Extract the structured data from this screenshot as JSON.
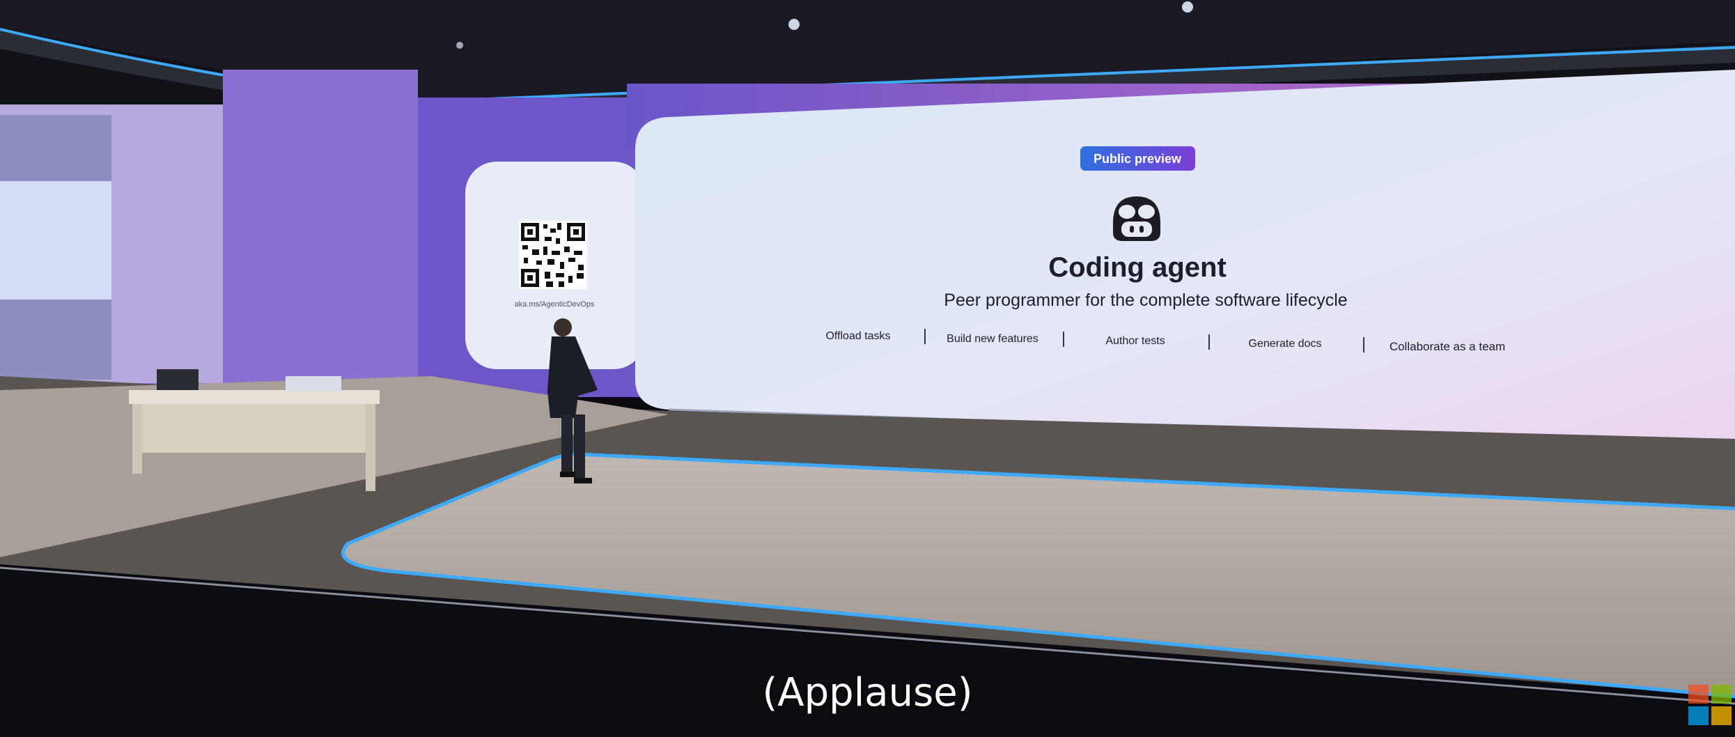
{
  "slide": {
    "badge": "Public preview",
    "title": "Coding agent",
    "subtitle": "Peer programmer for the complete software lifecycle",
    "features": [
      "Offload tasks",
      "Build new features",
      "Author tests",
      "Generate docs",
      "Collaborate as a team"
    ],
    "qr_url": "aka.ms/AgenticDevOps"
  },
  "caption": "(Applause)",
  "icons": {
    "agent": "copilot-agent-icon",
    "logo": "microsoft-logo"
  },
  "colors": {
    "accent_blue": "#3da9ff",
    "badge_start": "#2f6fe0",
    "badge_end": "#7a3fd8",
    "screen_bg": "#dfe6f6",
    "wall_purple": "#7c5fd0"
  }
}
